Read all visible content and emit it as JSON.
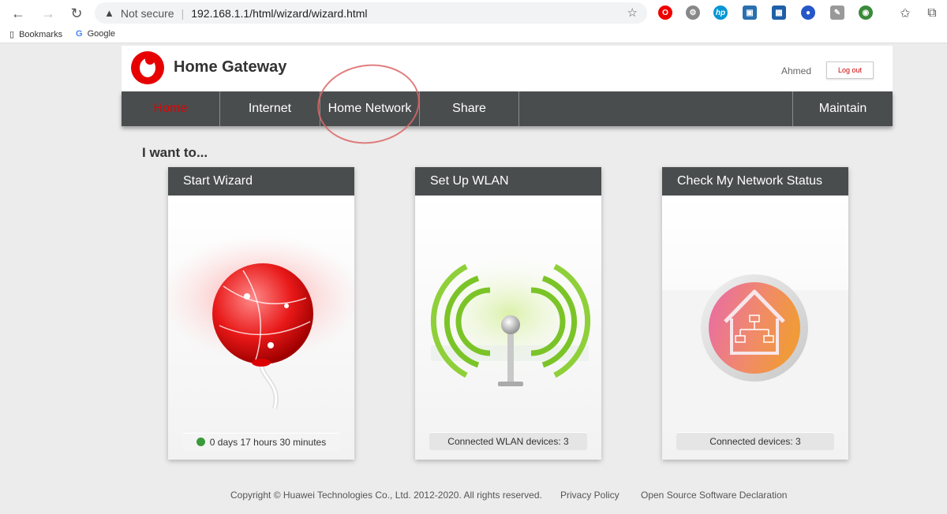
{
  "browser": {
    "security_label": "Not secure",
    "url": "192.168.1.1/html/wizard/wizard.html",
    "bookmarks": [
      "Bookmarks",
      "Google"
    ]
  },
  "header": {
    "title": "Home Gateway",
    "user": "Ahmed",
    "logout_label": "Log out"
  },
  "nav": {
    "items": [
      "Home",
      "Internet",
      "Home Network",
      "Share",
      "Maintain"
    ],
    "active": "Home"
  },
  "main": {
    "heading": "I want to...",
    "cards": [
      {
        "title": "Start Wizard",
        "status": "0 days 17 hours 30 minutes"
      },
      {
        "title": "Set Up WLAN",
        "status": "Connected WLAN devices: 3"
      },
      {
        "title": "Check My Network Status",
        "status": "Connected devices: 3"
      }
    ]
  },
  "footer": {
    "copyright": "Copyright © Huawei Technologies Co., Ltd. 2012-2020. All rights reserved.",
    "privacy": "Privacy Policy",
    "oss": "Open Source Software Declaration"
  },
  "colors": {
    "brand_red": "#e60000",
    "nav_bg": "#4a4d4e",
    "status_green": "#3a9a3a"
  }
}
